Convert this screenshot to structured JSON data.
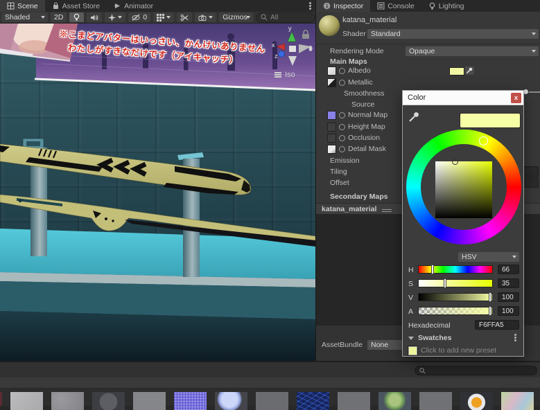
{
  "colors": {
    "albedo_css": "background:#F1F7A2",
    "picker_current_css": "background:#F6FFA5",
    "preset_css": "background:#EEF49C",
    "katana": "#C6C17A",
    "wall": "#2B525C",
    "shelf": "#49BCCD",
    "billboard_top": "#473A74",
    "billboard_bottom": "#9A74B4",
    "close_button": "#C05048"
  },
  "icons": {
    "scene_tab": "grid",
    "asset_store_tab": "bag",
    "animator_tab": "play",
    "inspector_tab": "info-circle",
    "console_tab": "lines",
    "lighting_tab": "bulb",
    "search": "magnifier",
    "eyedropper": "pipette",
    "lock": "padlock",
    "iso_menu": "menu-lines"
  },
  "scene": {
    "tabs": [
      {
        "label": "Scene"
      },
      {
        "label": "Asset Store"
      },
      {
        "label": "Animator"
      }
    ],
    "toolbar": {
      "shading": "Shaded",
      "mode_2d": "2D",
      "hidden_count": "0",
      "gizmos": "Gizmos",
      "search_value": "All"
    },
    "viewport": {
      "banner_line1": "※こまどアバターはいっさい、かんけいありません",
      "banner_line2": "わたしがすきなだけです（アイキャッチ）",
      "projection": "Iso",
      "axis": {
        "x": "x",
        "y": "y",
        "z": "z"
      }
    }
  },
  "inspector": {
    "tabs": [
      {
        "label": "Inspector"
      },
      {
        "label": "Console"
      },
      {
        "label": "Lighting"
      }
    ],
    "material_name": "katana_material",
    "shader_label": "Shader",
    "shader_value": "Standard",
    "rendering_mode_label": "Rendering Mode",
    "rendering_mode_value": "Opaque",
    "main_maps_label": "Main Maps",
    "map_rows": [
      "Albedo",
      "Metallic",
      "Smoothness",
      "Source",
      "Normal Map",
      "Height Map",
      "Occlusion",
      "Detail Mask",
      "Emission",
      "Tiling",
      "Offset"
    ],
    "secondary_maps_label": "Secondary Maps",
    "preview_title": "katana_material",
    "assetbundle_label": "AssetBundle",
    "assetbundle_value": "None"
  },
  "color_picker": {
    "title": "Color",
    "close": "x",
    "mode": "HSV",
    "sliders": [
      {
        "label": "H",
        "value": "66"
      },
      {
        "label": "S",
        "value": "35"
      },
      {
        "label": "V",
        "value": "100"
      },
      {
        "label": "A",
        "value": "100"
      }
    ],
    "hex_label": "Hexadecimal",
    "hex_value": "F6FFA5",
    "swatches_label": "Swatches",
    "preset_hint": "Click to add new preset"
  },
  "project": {
    "thumbs": [
      {
        "name": "light-gray-texture",
        "css": "background:linear-gradient(135deg,#bcbcbe,#a9a9ad)"
      },
      {
        "name": "mottled-gray-texture",
        "css": "background:radial-gradient(circle at 30% 40%,#9a9a9e,#838387)"
      },
      {
        "name": "dark-sphere-material",
        "css": "background:radial-gradient(circle at 50% 55%,#5c5e63 45%,#3c3e43 48%)"
      },
      {
        "name": "gray-texture",
        "css": "background:#85868a"
      },
      {
        "name": "purple-bump-texture",
        "css": "background:repeating-linear-gradient(90deg,rgba(0,0,40,.3) 0 1px,transparent 1px 4px),repeating-linear-gradient(0deg,rgba(255,255,255,.3) 0 1px,transparent 1px 4px),#7b74ea"
      },
      {
        "name": "blue-sphere-material",
        "css": "background:radial-gradient(circle at 45% 40%,#ccd6f8 0 38%,#8f9cd8 52%,#43454a 60%)"
      },
      {
        "name": "gray-texture",
        "css": "background:#6b6c70"
      },
      {
        "name": "blue-wireframe-asset",
        "css": "background:repeating-linear-gradient(25deg,rgba(70,120,255,.55) 0 1px,transparent 1px 6px),repeating-linear-gradient(-35deg,rgba(70,120,255,.45) 0 1px,transparent 1px 7px),#16255c"
      },
      {
        "name": "gray-texture",
        "css": "background:#707175"
      },
      {
        "name": "green-sphere-material",
        "css": "background:radial-gradient(circle at 50% 45%,#a8c47e 0 30%,#6d9a55 45%,#4a5560 60%)"
      },
      {
        "name": "gray-texture",
        "css": "background:#707175"
      },
      {
        "name": "hex-badge-asset",
        "css": "background:radial-gradient(circle at 50% 58%,#f0a020 0 26%,#e8e8ea 28% 44%,#2f3136 46%)"
      },
      {
        "name": "pastel-noise-texture",
        "css": "background:linear-gradient(120deg,#bcd7a0,#d8b8c8 40%,#a8c8d8 70%,#d8d0a0)"
      }
    ]
  }
}
